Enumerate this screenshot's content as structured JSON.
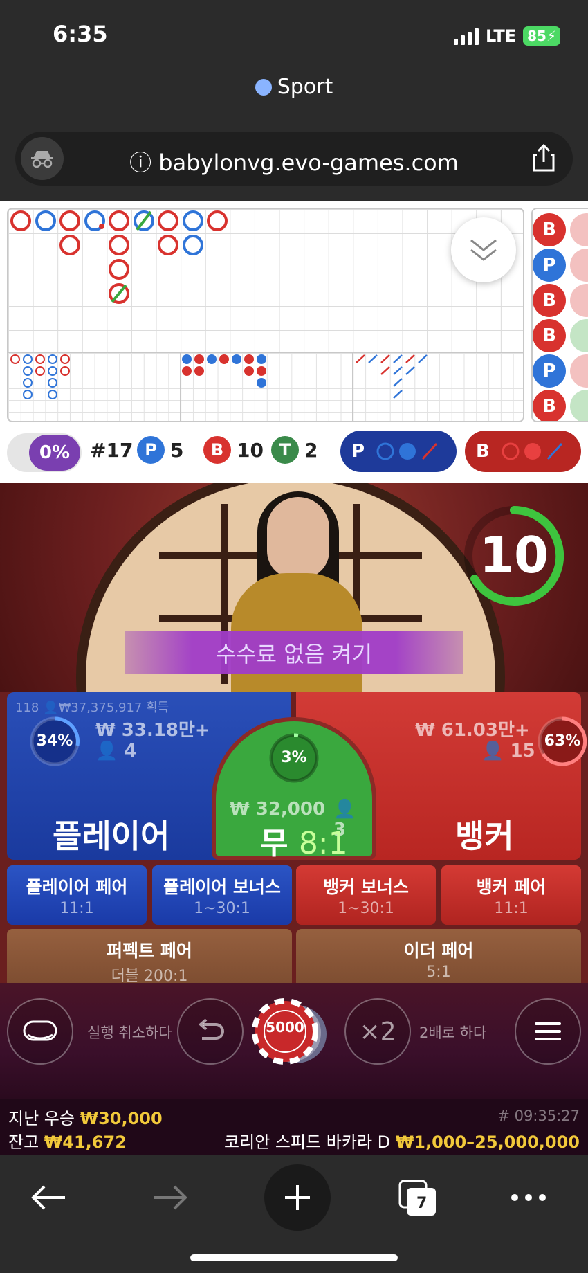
{
  "status": {
    "time": "6:35",
    "network": "LTE",
    "battery": "85"
  },
  "browser": {
    "tab_title": "Sport",
    "url": "babylonvg.evo-games.com",
    "tab_count": "7"
  },
  "roadmap": {
    "bead_plate": [
      "B",
      "P",
      "B",
      "B",
      "P",
      "B"
    ],
    "win_pct": "0%",
    "round": "#17",
    "player_label": "P",
    "player_count": "5",
    "banker_label": "B",
    "banker_count": "10",
    "tie_label": "T",
    "tie_count": "2",
    "player_ask": "P",
    "banker_ask": "B"
  },
  "video": {
    "timer": "10",
    "no_commission_label": "수수료 없음 켜기"
  },
  "betting": {
    "player": {
      "win_info": "118",
      "win_amount": "₩37,375,917 획득",
      "pct": "34%",
      "pct_value": 0.34,
      "amount": "₩ 33.18만+",
      "players": "4",
      "label": "플레이어"
    },
    "tie": {
      "pct": "3%",
      "pct_value": 0.03,
      "amount": "₩ 32,000",
      "players": "3",
      "label": "무",
      "payout": "8:1"
    },
    "banker": {
      "pct": "63%",
      "pct_value": 0.63,
      "amount": "₩ 61.03만+",
      "players": "15",
      "label": "뱅커"
    },
    "side_bets": [
      {
        "name": "플레이어 페어",
        "payout": "11:1"
      },
      {
        "name": "플레이어 보너스",
        "payout": "1~30:1"
      },
      {
        "name": "뱅커 보너스",
        "payout": "1~30:1"
      },
      {
        "name": "뱅커 페어",
        "payout": "11:1"
      }
    ],
    "perfect_pair": {
      "name": "퍼펙트 페어",
      "payout": "더블 200:1"
    },
    "either_pair": {
      "name": "이더 페어",
      "payout": "5:1"
    }
  },
  "controls": {
    "undo_label": "실행 취소하다",
    "chip_value": "5000",
    "double_symbol": "×2",
    "double_label": "2배로 하다"
  },
  "footer": {
    "last_win_label": "지난 우승",
    "last_win": "₩30,000",
    "game_id": "# 09:35:27",
    "balance_label": "잔고",
    "balance": "₩41,672",
    "table_name": "코리안 스피드 바카라 D",
    "limits": "₩1,000–25,000,000"
  },
  "colors": {
    "banker": "#d8322e",
    "player": "#2f74d8",
    "tie": "#3aa83e",
    "accent_gold": "#f2c93a"
  }
}
